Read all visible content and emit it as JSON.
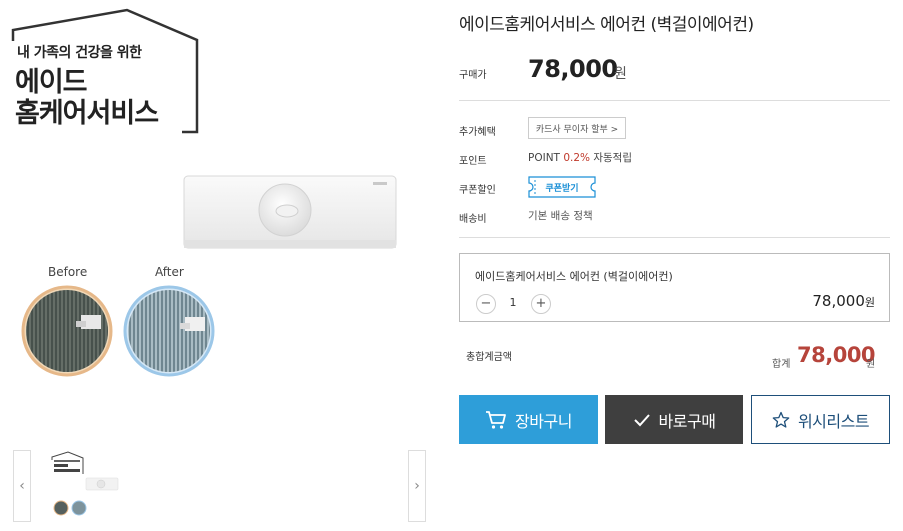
{
  "brand": {
    "tagline": "내 가족의 건강을 위한",
    "name_line1": "에이드",
    "name_line2": "홈케어서비스"
  },
  "before_after": {
    "before_label": "Before",
    "after_label": "After"
  },
  "thumbnails": {
    "prev_icon": "chevron-left-icon",
    "next_icon": "chevron-right-icon"
  },
  "product": {
    "title": "에이드홈케어서비스 에어컨 (벽걸이에어컨)",
    "price_label": "구매가",
    "price": "78,000",
    "price_unit": "원"
  },
  "info": {
    "benefit_label": "추가혜택",
    "card_button": "카드사 무이자 할부 >",
    "point_label": "포인트",
    "point_prefix": "POINT ",
    "point_rate": "0.2%",
    "point_suffix": " 자동적립",
    "coupon_label": "쿠폰할인",
    "coupon_button": "쿠폰받기",
    "shipping_label": "배송비",
    "shipping_value": "기본 배송 정책"
  },
  "option": {
    "name": "에이드홈케어서비스 에어컨 (벽걸이에어컨)",
    "minus": "−",
    "plus": "+",
    "quantity": "1",
    "price": "78,000",
    "price_unit": "원"
  },
  "total": {
    "label": "총합계금액",
    "sum_label": "합계",
    "value": "78,000",
    "unit": "원"
  },
  "actions": {
    "cart": "장바구니",
    "buy": "바로구매",
    "wishlist": "위시리스트"
  },
  "colors": {
    "cart_bg": "#2e9ed9",
    "buy_bg": "#3f3f3f",
    "wish_border": "#1e4f7a",
    "total_price": "#b6443b",
    "point_rate": "#c0392b",
    "coupon": "#1a8fd6"
  }
}
